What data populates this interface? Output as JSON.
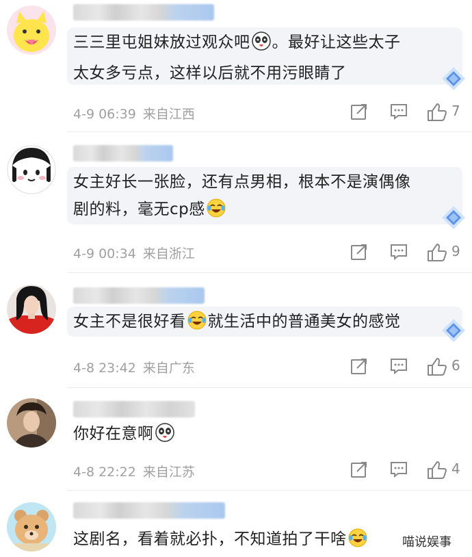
{
  "comments": [
    {
      "text_line1": "三三里屯姐妹放过观众吧",
      "text_line1b": "。最好让这些太子",
      "text_line2": "太女多亏点，这样以后就不用污眼睛了",
      "date": "4-9 06:39",
      "location": "来自江西",
      "likes": "7"
    },
    {
      "text_line1": "女主好长一张脸，还有点男相，根本不是演偶像",
      "text_line2": "剧的料，毫无cp感",
      "date": "4-9 00:34",
      "location": "来自浙江",
      "likes": "9"
    },
    {
      "text_line1": "女主不是很好看",
      "text_line1b": "就生活中的普通美女的感觉",
      "date": "4-8 23:42",
      "location": "来自广东",
      "likes": "6"
    },
    {
      "text_line1": "你好在意啊",
      "date": "4-8 22:22",
      "location": "来自江苏",
      "likes": "4"
    },
    {
      "text_line1": "这剧名，看着就必扑，不知道拍了干啥"
    }
  ],
  "watermark": "喵说娱事"
}
